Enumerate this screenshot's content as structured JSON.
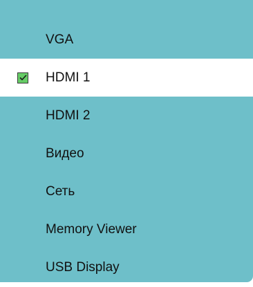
{
  "menu": {
    "items": [
      {
        "label": "VGA",
        "selected": false
      },
      {
        "label": "HDMI 1",
        "selected": true
      },
      {
        "label": "HDMI 2",
        "selected": false
      },
      {
        "label": "Видео",
        "selected": false
      },
      {
        "label": "Сеть",
        "selected": false
      },
      {
        "label": "Memory Viewer",
        "selected": false
      },
      {
        "label": "USB Display",
        "selected": false
      }
    ]
  },
  "colors": {
    "menu_background": "#6ebfc9",
    "selected_background": "#ffffff",
    "checkbox_fill": "#66cc66"
  },
  "icons": {
    "selected_marker": "checkbox-checked-icon"
  }
}
